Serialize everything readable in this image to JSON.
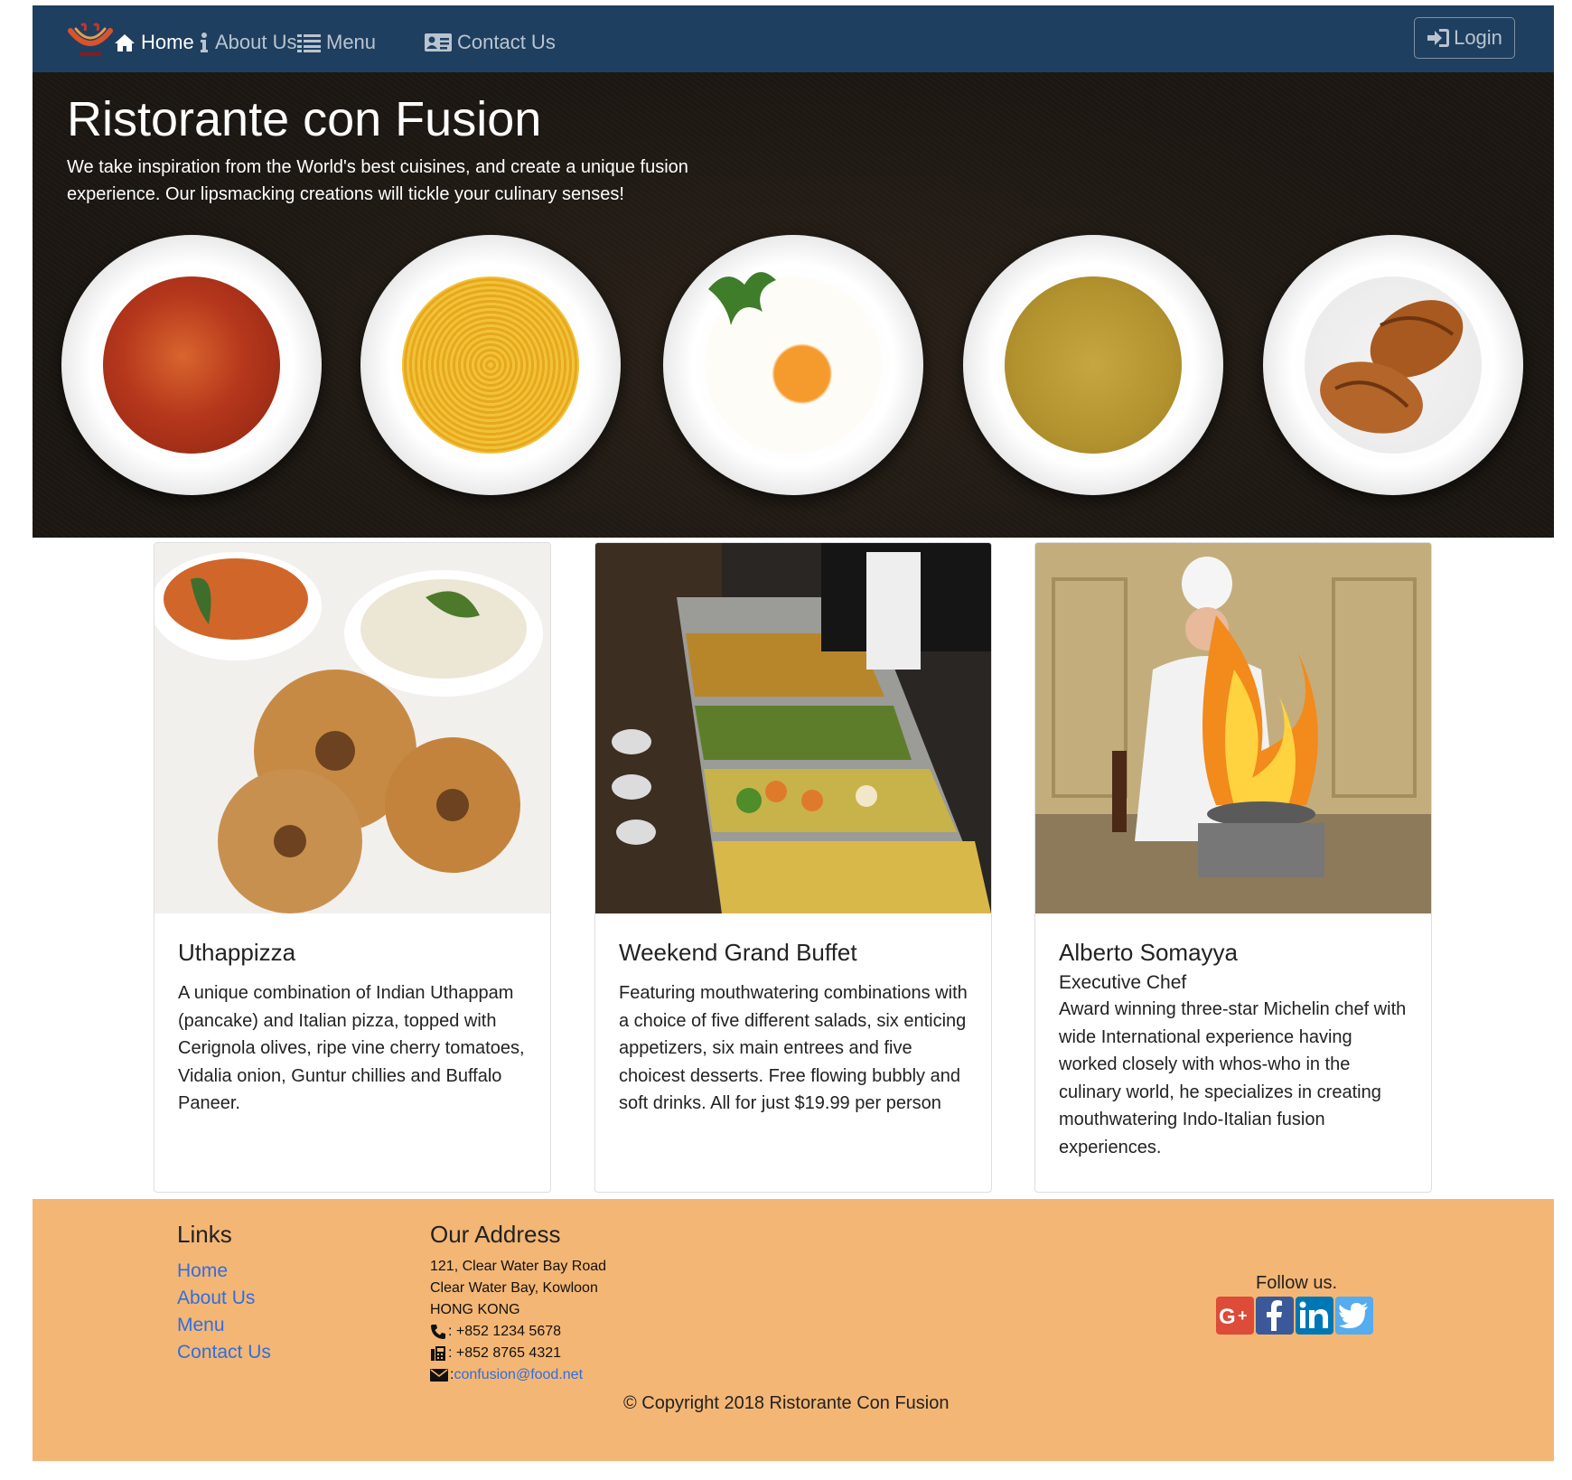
{
  "nav": {
    "items": [
      {
        "label": "Home",
        "icon": "home-icon",
        "active": true
      },
      {
        "label": "About Us",
        "icon": "info-icon",
        "active": false
      },
      {
        "label": "Menu",
        "icon": "list-icon",
        "active": false
      },
      {
        "label": "Contact Us",
        "icon": "address-card-icon",
        "active": false
      }
    ],
    "login_label": "Login"
  },
  "hero": {
    "title": "Ristorante con Fusion",
    "text": "We take inspiration from the World's best cuisines, and create a unique fusion experience. Our lipsmacking creations will tickle your culinary senses!"
  },
  "cards": [
    {
      "title": "Uthappizza",
      "subtitle": "",
      "text": "A unique combination of Indian Uthappam (pancake) and Italian pizza, topped with Cerignola olives, ripe vine cherry tomatoes, Vidalia onion, Guntur chillies and Buffalo Paneer."
    },
    {
      "title": "Weekend Grand Buffet",
      "subtitle": "",
      "text": "Featuring mouthwatering combinations with a choice of five different salads, six enticing appetizers, six main entrees and five choicest desserts. Free flowing bubbly and soft drinks. All for just $19.99 per person"
    },
    {
      "title": "Alberto Somayya",
      "subtitle": "Executive Chef",
      "text": "Award winning three-star Michelin chef with wide International experience having worked closely with whos-who in the culinary world, he specializes in creating mouthwatering Indo-Italian fusion experiences."
    }
  ],
  "footer": {
    "links_heading": "Links",
    "links": [
      "Home",
      "About Us",
      "Menu",
      "Contact Us"
    ],
    "address_heading": "Our Address",
    "address": [
      "121, Clear Water Bay Road",
      "Clear Water Bay, Kowloon",
      "HONG KONG"
    ],
    "phone": ": +852 1234 5678",
    "fax": ": +852 8765 4321",
    "email_prefix": ": ",
    "email": "confusion@food.net",
    "follow_label": "Follow us.",
    "social_icons": [
      "google-plus-icon",
      "facebook-icon",
      "linkedin-icon",
      "twitter-icon"
    ],
    "copyright": "© Copyright 2018 Ristorante Con Fusion"
  },
  "colors": {
    "navbar": "#1f3f60",
    "footer": "#f4b674",
    "link": "#2f6ee0",
    "google": "#dd4b39",
    "facebook": "#3b5998",
    "linkedin": "#0077b5",
    "twitter": "#55acee"
  }
}
